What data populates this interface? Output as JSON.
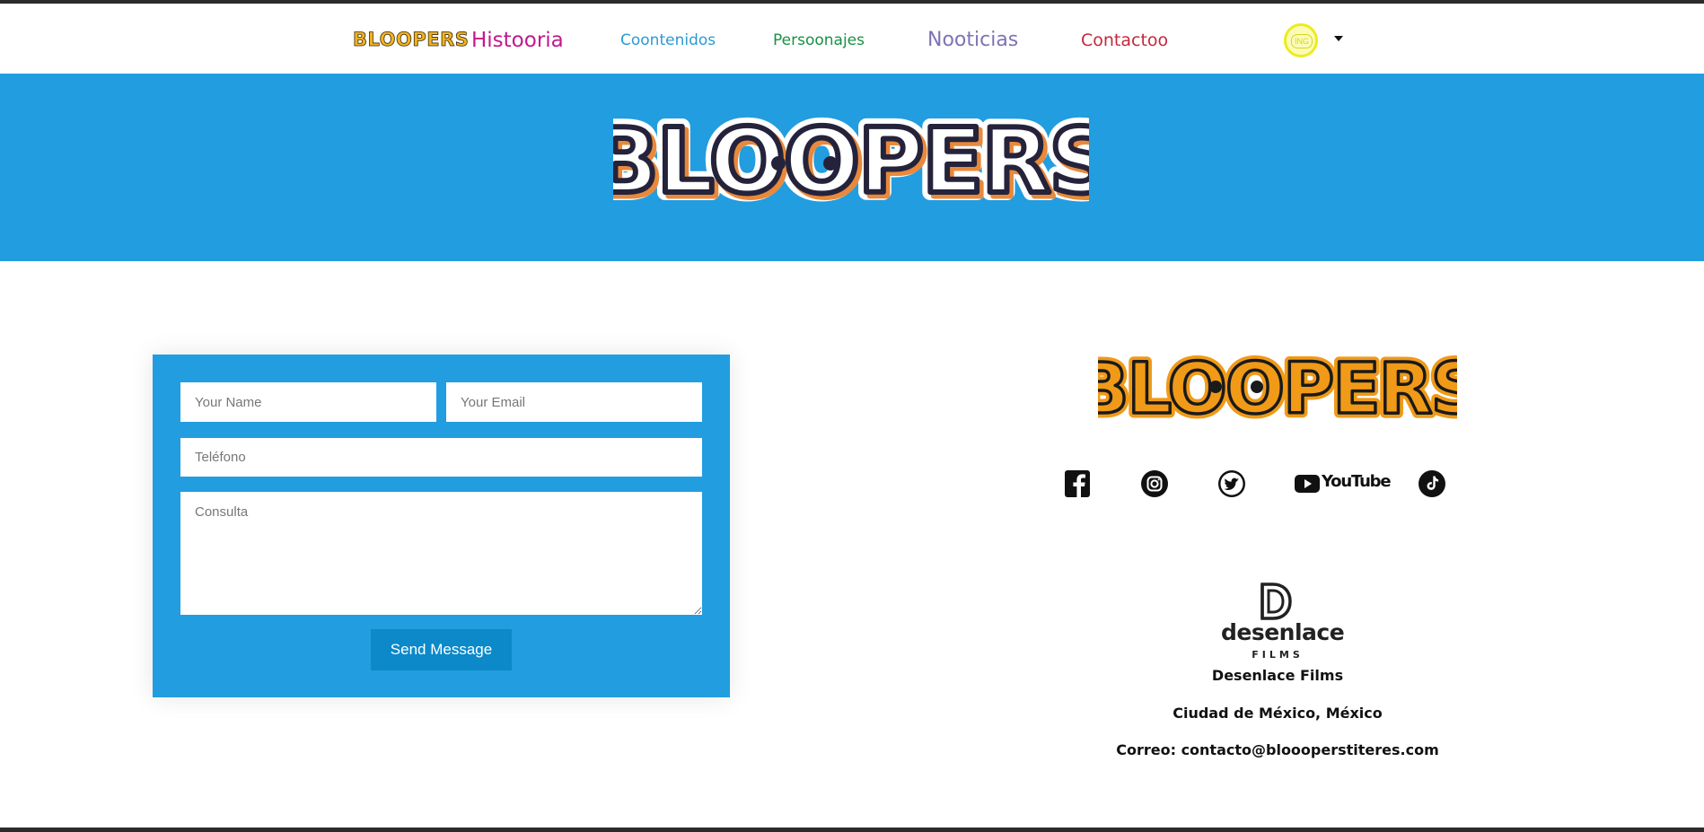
{
  "nav": {
    "logo": "BLOOPERS",
    "items": [
      {
        "label": "Histooria",
        "color": "#c3188d"
      },
      {
        "label": "Coontenidos",
        "color": "#2c9ad4"
      },
      {
        "label": "Persoonajes",
        "color": "#199144"
      },
      {
        "label": "Nooticias",
        "color": "#7d74b5"
      },
      {
        "label": "Contactoo",
        "color": "#c4283b"
      }
    ],
    "language": {
      "label": "ING",
      "icon": "speech-bubble-icon"
    }
  },
  "hero": {
    "logo_text": "BLOOPERS",
    "background": "#229ddf"
  },
  "form": {
    "name_placeholder": "Your Name",
    "email_placeholder": "Your Email",
    "phone_placeholder": "Teléfono",
    "message_placeholder": "Consulta",
    "submit_label": "Send Message",
    "background": "#229ddf",
    "button_color": "#0b89c9"
  },
  "sidebar": {
    "logo_text": "BLOOPERS",
    "social": [
      {
        "name": "facebook-icon"
      },
      {
        "name": "instagram-icon"
      },
      {
        "name": "twitter-icon"
      },
      {
        "name": "youtube-icon",
        "label": "YouTube"
      },
      {
        "name": "tiktok-icon"
      }
    ],
    "company_logo": {
      "word": "desenlace",
      "sub": "FILMS"
    },
    "company": "Desenlace Films",
    "city": "Ciudad de México, México",
    "email": "Correo: contacto@bloooperstiteres.com"
  }
}
